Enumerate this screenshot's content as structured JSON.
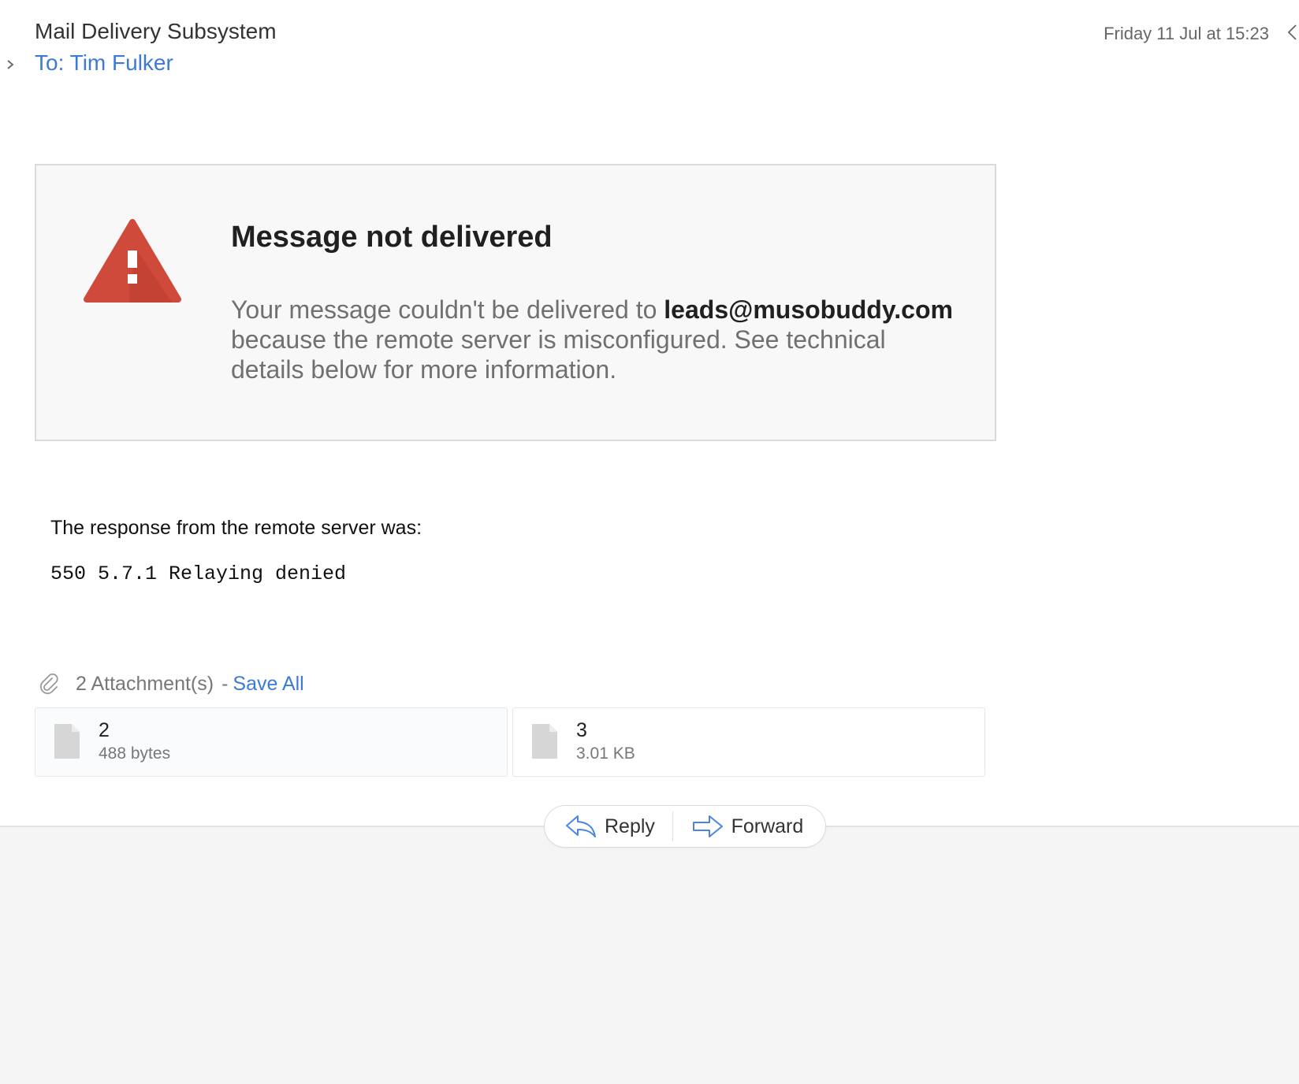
{
  "header": {
    "sender": "Mail Delivery Subsystem",
    "recipient": "To: Tim Fulker",
    "date": "Friday 11 Jul at 15:23"
  },
  "alert": {
    "title": "Message not delivered",
    "body_prefix": "Your message couldn't be delivered to ",
    "address": "leads@musobuddy.com",
    "body_suffix": " because the remote server is misconfigured. See technical details below for more information."
  },
  "response": {
    "label": "The response from the remote server was:",
    "code": "550 5.7.1 Relaying denied"
  },
  "attachments": {
    "count_label": "2 Attachment(s)",
    "separator": "-",
    "save_all_label": "Save All",
    "items": [
      {
        "name": "2",
        "size": "488 bytes"
      },
      {
        "name": "3",
        "size": "3.01 KB"
      }
    ]
  },
  "actions": {
    "reply_label": "Reply",
    "forward_label": "Forward"
  },
  "icons": {
    "expand": "chevron-right-icon",
    "back": "chevron-left-icon",
    "warning": "warning-triangle-icon",
    "paperclip": "paperclip-icon",
    "file": "file-icon",
    "reply": "reply-arrow-icon",
    "forward": "forward-arrow-icon"
  },
  "colors": {
    "link": "#3d7ad6",
    "warning_red": "#d04a3b",
    "warning_dark": "#b93d30",
    "icon_blue": "#4a86e0",
    "file_gray": "#d6d6d6"
  }
}
